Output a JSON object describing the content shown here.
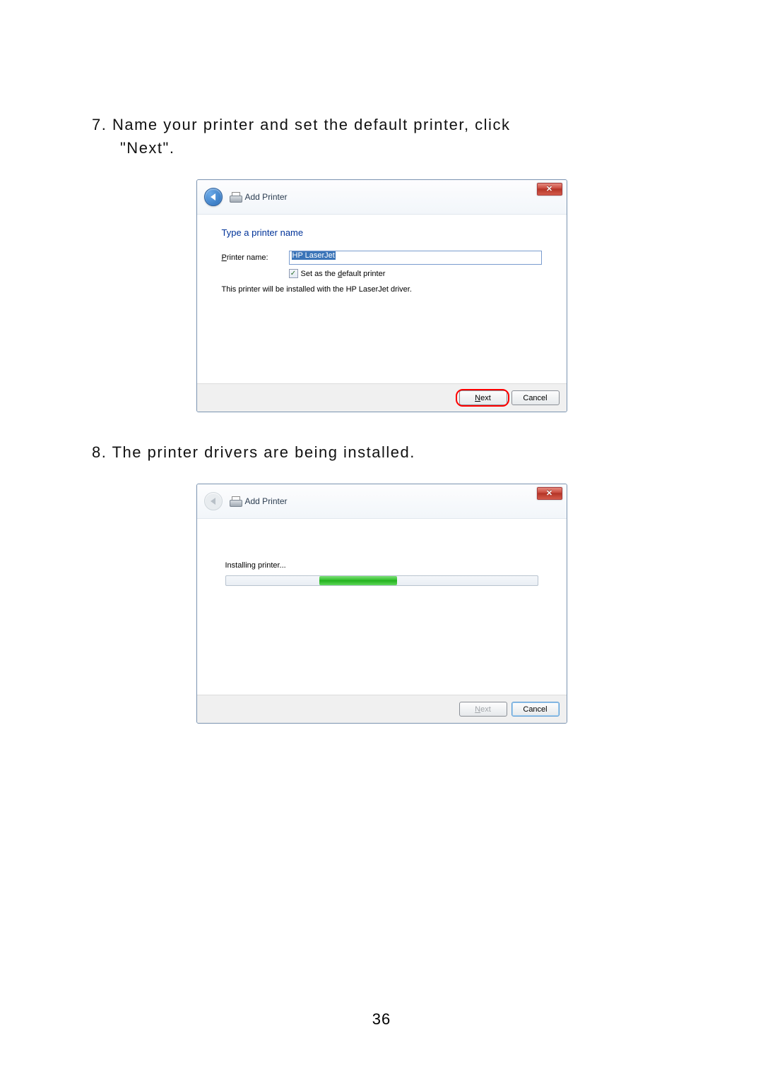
{
  "step7": {
    "number": "7.",
    "text_line1": "Name your printer and set the default printer, click",
    "text_line2": "\"Next\"."
  },
  "step8": {
    "number": "8.",
    "text": "The printer drivers are being installed."
  },
  "dialog1": {
    "title": "Add Printer",
    "heading": "Type a printer name",
    "printer_label_pre": "P",
    "printer_label_post": "rinter name:",
    "printer_value": "HP LaserJet",
    "checkbox_pre": "Set as the ",
    "checkbox_u": "d",
    "checkbox_post": "efault printer",
    "info": "This printer will be installed with the HP LaserJet driver.",
    "next_u": "N",
    "next_post": "ext",
    "cancel": "Cancel"
  },
  "dialog2": {
    "title": "Add Printer",
    "progress_text": "Installing printer...",
    "next_u": "N",
    "next_post": "ext",
    "cancel": "Cancel"
  },
  "page_number": "36"
}
